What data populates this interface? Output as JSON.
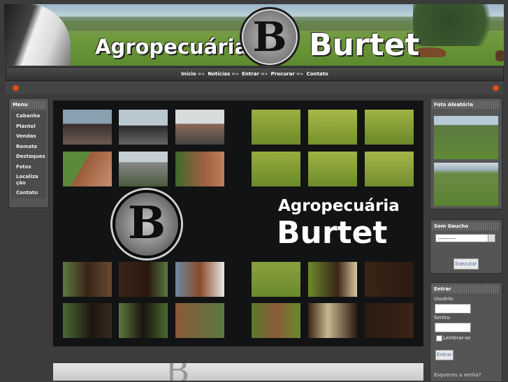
{
  "header": {
    "title_part1": "Agropecuária",
    "title_part2": "Burtet",
    "logo_letter": "B"
  },
  "nav": {
    "items": [
      "Início",
      "Notícias",
      "Entrar",
      "Procurar",
      "Contato"
    ],
    "separator": "=»"
  },
  "menu": {
    "title": "Menu",
    "items": [
      "Cabanha",
      "Plantel",
      "Vendas",
      "Remate",
      "Destaques",
      "Fotos",
      "Localização",
      "Contato"
    ]
  },
  "main": {
    "title1": "Agropecuária",
    "title2": "Burtet",
    "logo_letter": "B"
  },
  "foto": {
    "title": "Foto Aleatória"
  },
  "som": {
    "title": "Som Gaucho",
    "select_value": "----------",
    "button": "Executar"
  },
  "login": {
    "title": "Entrar",
    "user_label": "Usuário:",
    "pass_label": "Senha:",
    "remember_label": "Lembrar-se",
    "button": "Entrar",
    "forgot": "Esqueceu a senha?"
  },
  "colors": {
    "background": "#3c3c3c",
    "panel": "#555555",
    "showcase": "#121314",
    "accent_apple": "#e05010"
  }
}
